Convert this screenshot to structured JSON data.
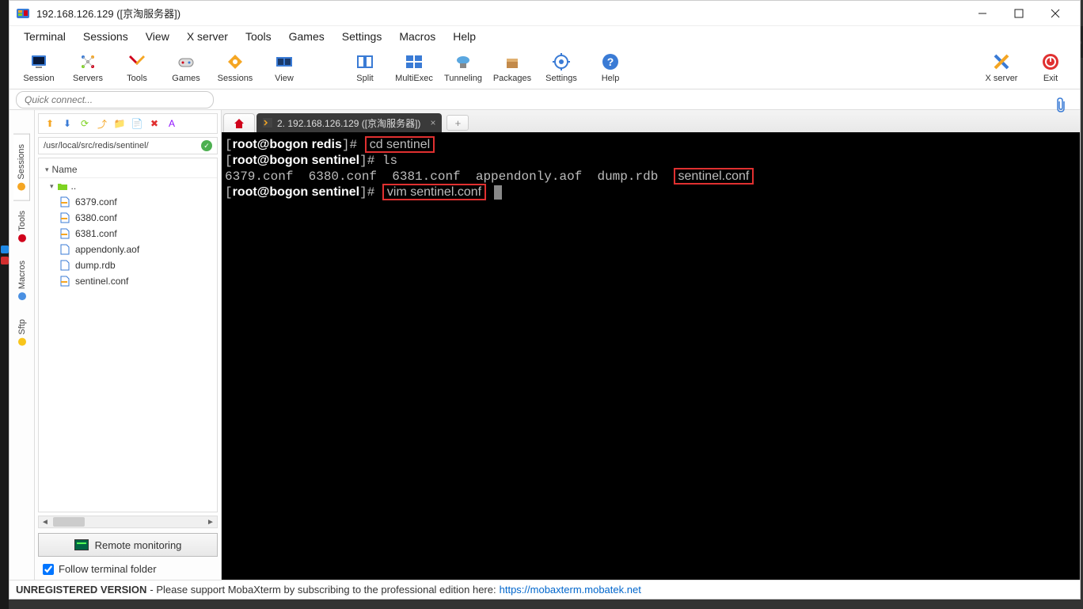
{
  "title": "192.168.126.129 ([京淘服务器])",
  "menubar": [
    "Terminal",
    "Sessions",
    "View",
    "X server",
    "Tools",
    "Games",
    "Settings",
    "Macros",
    "Help"
  ],
  "toolbar": [
    {
      "label": "Session",
      "icon": "session"
    },
    {
      "label": "Servers",
      "icon": "servers"
    },
    {
      "label": "Tools",
      "icon": "tools"
    },
    {
      "label": "Games",
      "icon": "games"
    },
    {
      "label": "Sessions",
      "icon": "sessions"
    },
    {
      "label": "View",
      "icon": "view"
    },
    {
      "label": "Split",
      "icon": "split"
    },
    {
      "label": "MultiExec",
      "icon": "multiexec"
    },
    {
      "label": "Tunneling",
      "icon": "tunneling"
    },
    {
      "label": "Packages",
      "icon": "packages"
    },
    {
      "label": "Settings",
      "icon": "settings"
    },
    {
      "label": "Help",
      "icon": "help"
    }
  ],
  "toolbar_right": [
    {
      "label": "X server",
      "icon": "xserver"
    },
    {
      "label": "Exit",
      "icon": "exit"
    }
  ],
  "quick_connect_placeholder": "Quick connect...",
  "rail_tabs": [
    {
      "label": "Sessions",
      "color": "#f5a623"
    },
    {
      "label": "Tools",
      "color": "#d0021b"
    },
    {
      "label": "Macros",
      "color": "#4a90e2"
    },
    {
      "label": "Sftp",
      "color": "#f8c51c"
    }
  ],
  "path": "/usr/local/src/redis/sentinel/",
  "tree_header": "Name",
  "parent_dir": "..",
  "files": [
    {
      "name": "6379.conf",
      "type": "conf"
    },
    {
      "name": "6380.conf",
      "type": "conf"
    },
    {
      "name": "6381.conf",
      "type": "conf"
    },
    {
      "name": "appendonly.aof",
      "type": "file"
    },
    {
      "name": "dump.rdb",
      "type": "file"
    },
    {
      "name": "sentinel.conf",
      "type": "conf"
    }
  ],
  "remote_monitoring": "Remote monitoring",
  "follow_label": "Follow terminal folder",
  "follow_checked": true,
  "term_tab_label": "2.  192.168.126.129 ([京淘服务器])",
  "terminal_lines": [
    {
      "prompt": "[root@bogon redis]# ",
      "cmd": "cd sentinel",
      "box": "cmd"
    },
    {
      "prompt": "[root@bogon sentinel]# ",
      "cmd": "ls"
    },
    {
      "ls": "6379.conf  6380.conf  6381.conf  appendonly.aof  dump.rdb  ",
      "boxed": "sentinel.conf"
    },
    {
      "prompt": "[root@bogon sentinel]# ",
      "cmd": "vim sentinel.conf",
      "box": "cmd",
      "cursor": true
    }
  ],
  "status": {
    "bold": "UNREGISTERED VERSION",
    "text": "  -  Please support MobaXterm by subscribing to the professional edition here:  ",
    "link": "https://mobaxterm.mobatek.net"
  }
}
